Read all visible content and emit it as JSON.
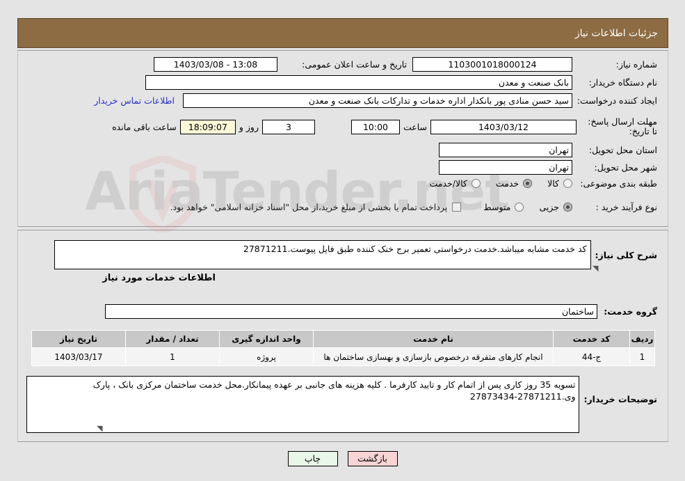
{
  "header": {
    "title": "جزئیات اطلاعات نیاز",
    "bg": "#8d6b43",
    "fg": "#ffffff"
  },
  "top_form": {
    "need_number": {
      "label": "شماره نیاز:",
      "value": "1103001018000124"
    },
    "announce_datetime": {
      "label": "تاریخ و ساعت اعلان عمومی:",
      "value": "13:08 - 1403/03/08"
    },
    "buyer_org": {
      "label": "نام دستگاه خریدار:",
      "value": "بانک صنعت و معدن"
    },
    "creator": {
      "label": "ایجاد کننده درخواست:",
      "value": "سید حسن منادی پور بانکدار اداره خدمات و تدارکات بانک صنعت و معدن"
    },
    "contact_link": {
      "label": "اطلاعات تماس خریدار",
      "color": "#2630c8"
    },
    "deadline": {
      "label": "مهلت ارسال پاسخ: تا تاریخ:",
      "date": "1403/03/12",
      "time_label": "ساعت",
      "time": "10:00",
      "days": "3",
      "days_label": "روز و",
      "countdown": "18:09:07",
      "countdown_label": "ساعت باقی مانده",
      "countdown_bg": "#fbf8d8"
    },
    "province": {
      "label": "استان محل تحویل:",
      "value": "تهران"
    },
    "city": {
      "label": "شهر محل تحویل:",
      "value": "تهران"
    },
    "category": {
      "label": "طبقه بندی موضوعی:",
      "options": [
        {
          "label": "کالا",
          "selected": false
        },
        {
          "label": "خدمت",
          "selected": true
        },
        {
          "label": "کالا/خدمت",
          "selected": false
        }
      ]
    },
    "purchase_type": {
      "label": "نوع فرآیند خرید :",
      "options": [
        {
          "label": "جزیی",
          "selected": true
        },
        {
          "label": "متوسط",
          "selected": false
        }
      ]
    },
    "treasury_note": {
      "checked": false,
      "text": "پرداخت تمام یا بخشی از مبلغ خرید،از محل \"اسناد خزانه اسلامی\" خواهد بود."
    }
  },
  "bottom_form": {
    "general_desc": {
      "label": "شرح کلی نیاز:",
      "value": "کد خدمت مشابه میباشد.خدمت درخواستی تعمیر برج خنک کننده طبق فایل پیوست.27871211"
    },
    "section_heading": "اطلاعات خدمات مورد نیاز",
    "service_group": {
      "label": "گروه خدمت:",
      "value": "ساختمان"
    },
    "table": {
      "columns": [
        "ردیف",
        "کد خدمت",
        "نام خدمت",
        "واحد اندازه گیری",
        "تعداد / مقدار",
        "تاریخ نیاز"
      ],
      "rows": [
        {
          "index": "1",
          "code": "ج-44",
          "name": "انجام کارهای متفرقه درخصوص بازسازی و بهسازی ساختمان ها",
          "unit": "پروژه",
          "quantity": "1",
          "need_date": "1403/03/17"
        }
      ]
    },
    "buyer_notes": {
      "label": "توضیحات خریدار:",
      "value": "تسویه 35 روز کاری پس از اتمام کار و تایید کارفرما . کلیه هزینه های جانبی بر عهده پیمانکار.محل خدمت ساختمان مرکزی بانک ، پارک وی.27871211-27873434"
    }
  },
  "footer": {
    "print_label": "چاپ",
    "back_label": "بازگشت",
    "print_bg": "#e9f7e9",
    "back_bg": "#f9d4d4"
  },
  "watermark": {
    "text": "AriaTender.net",
    "color": "#c9c9c9"
  }
}
